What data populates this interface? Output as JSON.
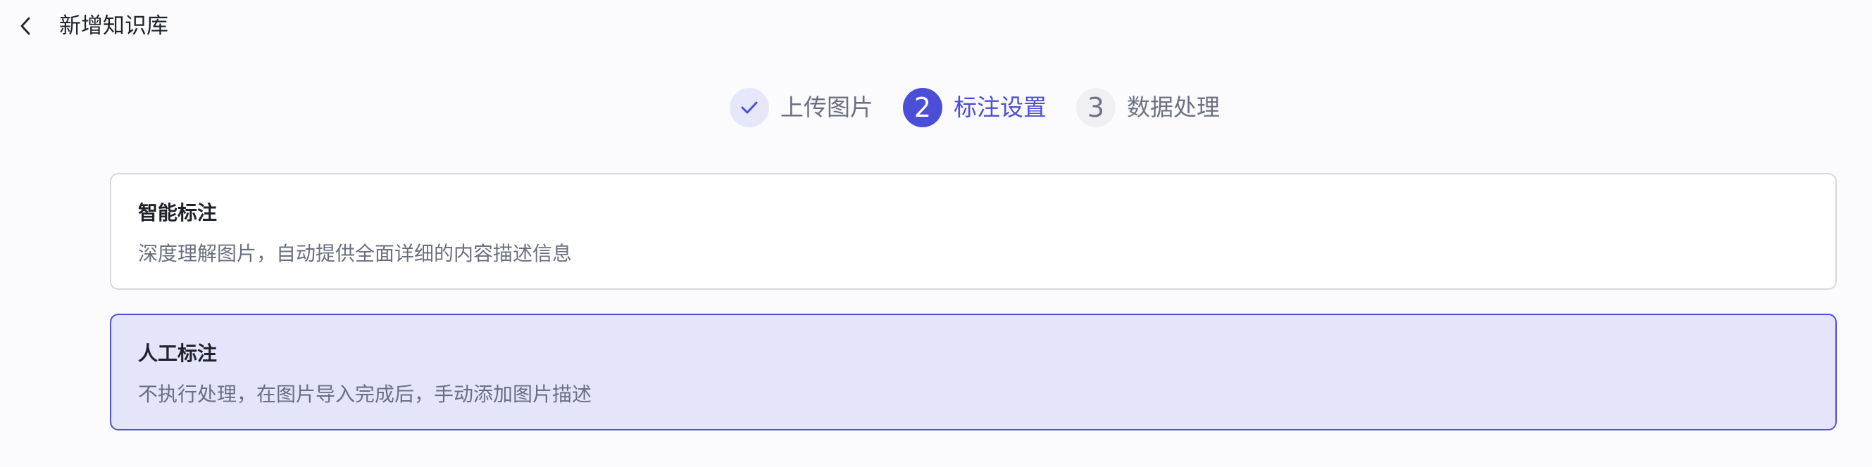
{
  "header": {
    "title": "新增知识库",
    "back_icon": "chevron-left-icon"
  },
  "steps": [
    {
      "number": "1",
      "label": "上传图片",
      "status": "done",
      "icon": "check-icon"
    },
    {
      "number": "2",
      "label": "标注设置",
      "status": "active"
    },
    {
      "number": "3",
      "label": "数据处理",
      "status": "pending"
    }
  ],
  "options": [
    {
      "title": "智能标注",
      "description": "深度理解图片，自动提供全面详细的内容描述信息",
      "selected": false
    },
    {
      "title": "人工标注",
      "description": "不执行处理，在图片导入完成后，手动添加图片描述",
      "selected": true
    }
  ],
  "colors": {
    "accent": "#4b4fd8",
    "selected_bg": "#e4e5fb",
    "page_bg": "#fbfbfe",
    "text_primary": "#1f2329",
    "text_secondary": "#6b6f80"
  }
}
